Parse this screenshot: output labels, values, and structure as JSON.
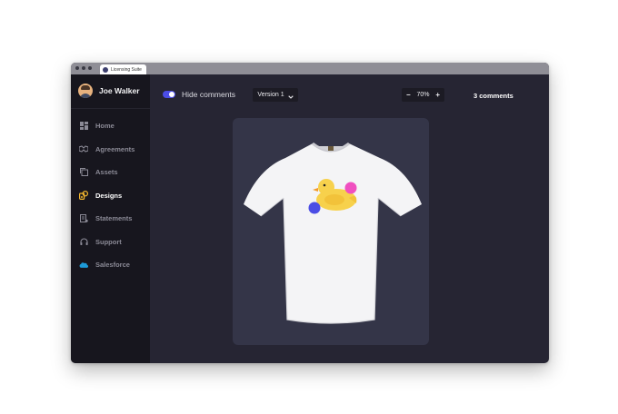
{
  "browser": {
    "tab_title": "Licensing Suite"
  },
  "user": {
    "name": "Joe Walker"
  },
  "sidebar": {
    "items": [
      {
        "label": "Home",
        "icon": "home-icon",
        "active": false
      },
      {
        "label": "Agreements",
        "icon": "agreements-icon",
        "active": false
      },
      {
        "label": "Assets",
        "icon": "assets-icon",
        "active": false
      },
      {
        "label": "Designs",
        "icon": "designs-icon",
        "active": true
      },
      {
        "label": "Statements",
        "icon": "statements-icon",
        "active": false
      },
      {
        "label": "Support",
        "icon": "headset-icon",
        "active": false
      },
      {
        "label": "Salesforce",
        "icon": "salesforce-cloud-icon",
        "active": false
      }
    ]
  },
  "toolbar": {
    "hide_comments_label": "Hide comments",
    "hide_comments_on": true,
    "version_label": "Version 1",
    "zoom_minus": "−",
    "zoom_level": "70%",
    "zoom_plus": "+",
    "comments_count": "3 comments"
  },
  "colors": {
    "accent": "#4b4de5",
    "active_nav": "#f5b82e",
    "comment_pink": "#f04fc0",
    "comment_blue": "#4b4de5",
    "sidebar_bg": "#17161e",
    "main_bg": "#262533",
    "canvas_bg": "#343548"
  }
}
